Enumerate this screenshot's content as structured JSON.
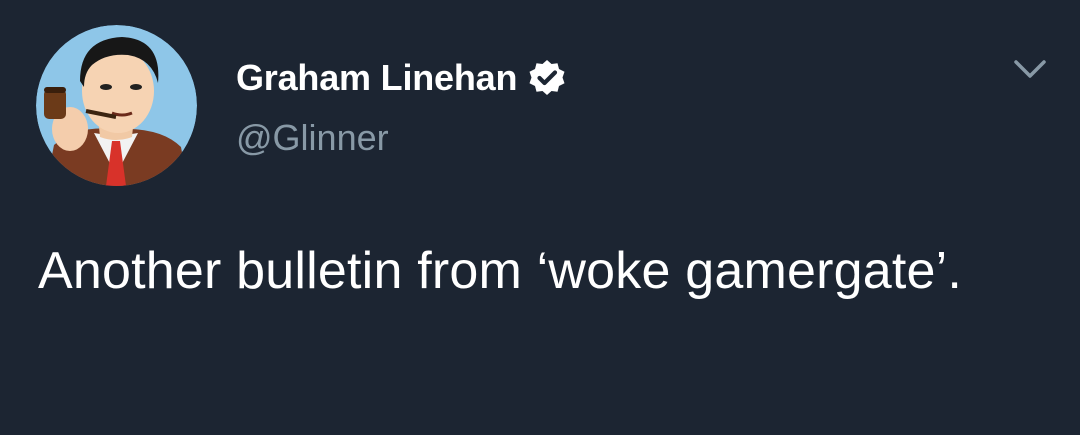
{
  "tweet": {
    "author": {
      "display_name": "Graham Linehan",
      "handle": "@Glinner",
      "verified": true,
      "avatar_icon": "cartoon-man-with-pipe-avatar"
    },
    "text": "Another bulletin from ‘woke gamergate’.",
    "menu_icon": "chevron-down-icon"
  },
  "colors": {
    "background": "#1c2532",
    "primary_text": "#ffffff",
    "secondary_text": "#8899a6",
    "chevron": "#8899a6",
    "avatar_background": "#8ec6e8"
  }
}
